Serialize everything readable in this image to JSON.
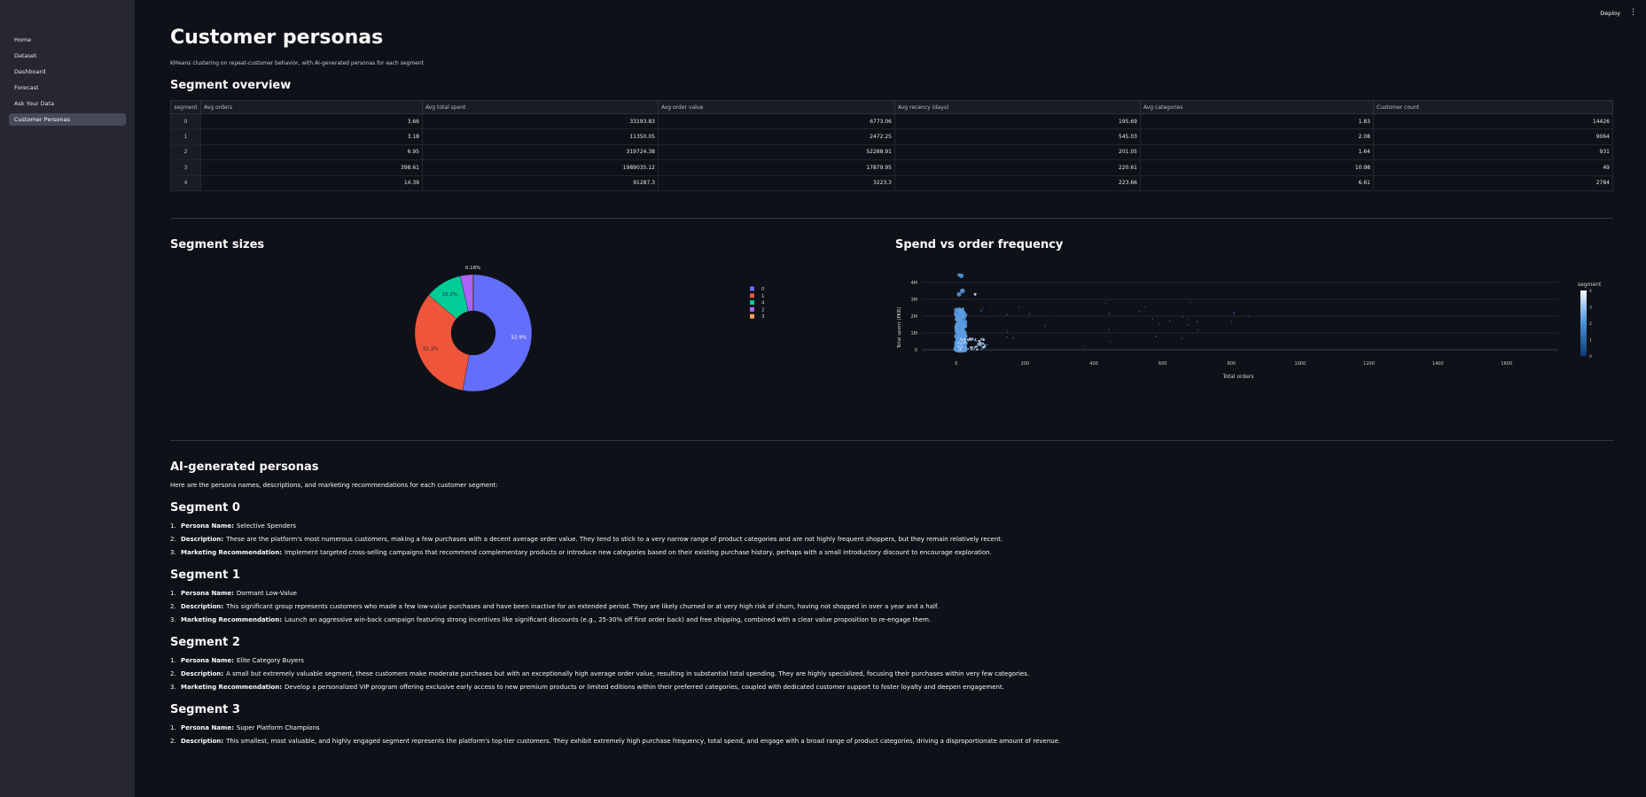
{
  "sidebar": {
    "items": [
      {
        "label": "Home"
      },
      {
        "label": "Dataset"
      },
      {
        "label": "Dashboard"
      },
      {
        "label": "Forecast"
      },
      {
        "label": "Ask Your Data"
      },
      {
        "label": "Customer Personas"
      }
    ],
    "active": "Customer Personas"
  },
  "topbar": {
    "deploy_label": "Deploy",
    "menu_icon": "more-vertical-icon"
  },
  "page": {
    "title": "Customer personas",
    "caption": "KMeans clustering on repeat-customer behavior, with AI-generated personas for each segment"
  },
  "overview": {
    "heading": "Segment overview",
    "columns": [
      "segment",
      "Avg orders",
      "Avg total spent",
      "Avg order value",
      "Avg recency (days)",
      "Avg categories",
      "Customer count"
    ],
    "rows": [
      [
        "0",
        "3.66",
        "33193.83",
        "6773.06",
        "195.69",
        "1.83",
        "14426"
      ],
      [
        "1",
        "3.18",
        "11350.05",
        "2472.25",
        "545.03",
        "2.08",
        "9064"
      ],
      [
        "2",
        "6.95",
        "319724.38",
        "52288.91",
        "201.05",
        "1.64",
        "931"
      ],
      [
        "3",
        "398.61",
        "1989035.12",
        "17879.95",
        "220.61",
        "10.98",
        "49"
      ],
      [
        "4",
        "14.39",
        "91287.3",
        "3223.3",
        "223.66",
        "6.61",
        "2784"
      ]
    ]
  },
  "colors": {
    "seg0": "#636efa",
    "seg1": "#ef553b",
    "seg4": "#00cc96",
    "seg2": "#ab63fa",
    "seg3": "#ffa15a"
  },
  "chart_data": [
    {
      "type": "pie",
      "title": "Segment sizes",
      "categories": [
        "0",
        "1",
        "4",
        "2",
        "3"
      ],
      "values": [
        52.9,
        33.3,
        10.2,
        3.42,
        0.18
      ],
      "labels": [
        "52.9%",
        "33.3%",
        "10.2%",
        "",
        "0.18%"
      ],
      "hole": true,
      "legend": "right"
    },
    {
      "type": "scatter",
      "title": "Spend vs order frequency",
      "xlabel": "Total orders",
      "ylabel": "Total spent (PKR)",
      "xlim": [
        -100,
        1750
      ],
      "ylim": [
        0,
        4000000
      ],
      "xticks": [
        "0",
        "200",
        "400",
        "600",
        "800",
        "1000",
        "1200",
        "1400",
        "1600"
      ],
      "xtick_values": [
        0,
        200,
        400,
        600,
        800,
        1000,
        1200,
        1400,
        1600
      ],
      "yticks": [
        "0",
        "1M",
        "2M",
        "3M",
        "4M"
      ],
      "ytick_values": [
        0,
        1000000,
        2000000,
        3000000,
        4000000
      ],
      "colorbar_title": "segment",
      "colorbar_ticks": [
        "0",
        "1",
        "2",
        "3",
        "4"
      ]
    }
  ],
  "personas": {
    "heading": "AI-generated personas",
    "intro": "Here are the persona names, descriptions, and marketing recommendations for each customer segment:",
    "segments": [
      {
        "title": "Segment 0",
        "items": [
          {
            "n": "1.",
            "label": "Persona Name:",
            "text": "Selective Spenders"
          },
          {
            "n": "2.",
            "label": "Description:",
            "text": "These are the platform's most numerous customers, making a few purchases with a decent average order value. They tend to stick to a very narrow range of product categories and are not highly frequent shoppers, but they remain relatively recent."
          },
          {
            "n": "3.",
            "label": "Marketing Recommendation:",
            "text": "Implement targeted cross-selling campaigns that recommend complementary products or introduce new categories based on their existing purchase history, perhaps with a small introductory discount to encourage exploration."
          }
        ]
      },
      {
        "title": "Segment 1",
        "items": [
          {
            "n": "1.",
            "label": "Persona Name:",
            "text": "Dormant Low-Value"
          },
          {
            "n": "2.",
            "label": "Description:",
            "text": "This significant group represents customers who made a few low-value purchases and have been inactive for an extended period. They are likely churned or at very high risk of churn, having not shopped in over a year and a half."
          },
          {
            "n": "3.",
            "label": "Marketing Recommendation:",
            "text": "Launch an aggressive win-back campaign featuring strong incentives like significant discounts (e.g., 25-30% off first order back) and free shipping, combined with a clear value proposition to re-engage them."
          }
        ]
      },
      {
        "title": "Segment 2",
        "items": [
          {
            "n": "1.",
            "label": "Persona Name:",
            "text": "Elite Category Buyers"
          },
          {
            "n": "2.",
            "label": "Description:",
            "text": "A small but extremely valuable segment, these customers make moderate purchases but with an exceptionally high average order value, resulting in substantial total spending. They are highly specialized, focusing their purchases within very few categories."
          },
          {
            "n": "3.",
            "label": "Marketing Recommendation:",
            "text": "Develop a personalized VIP program offering exclusive early access to new premium products or limited editions within their preferred categories, coupled with dedicated customer support to foster loyalty and deepen engagement."
          }
        ]
      },
      {
        "title": "Segment 3",
        "items": [
          {
            "n": "1.",
            "label": "Persona Name:",
            "text": "Super Platform Champions"
          },
          {
            "n": "2.",
            "label": "Description:",
            "text": "This smallest, most valuable, and highly engaged segment represents the platform's top-tier customers. They exhibit extremely high purchase frequency, total spend, and engage with a broad range of product categories, driving a disproportionate amount of revenue."
          }
        ]
      }
    ]
  }
}
